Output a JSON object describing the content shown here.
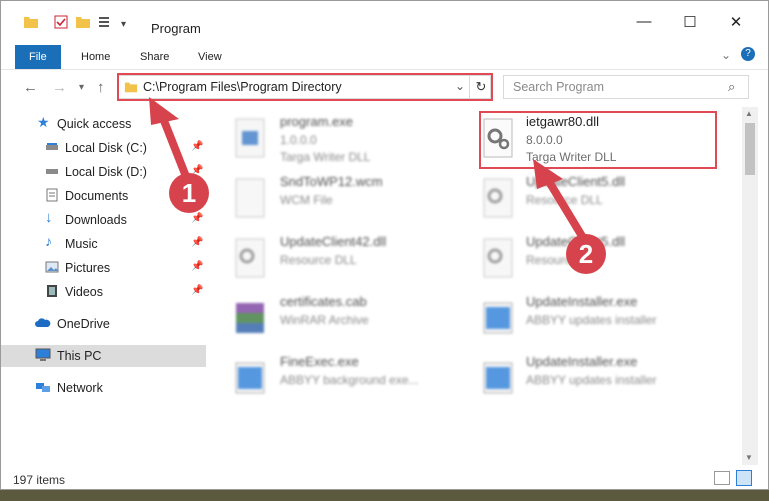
{
  "window": {
    "title": "Program",
    "minimize": "—",
    "maximize": "☐",
    "close": "✕"
  },
  "ribbon": {
    "tabs": [
      "File",
      "Home",
      "Share",
      "View"
    ]
  },
  "nav": {
    "address": "C:\\Program Files\\Program Directory",
    "search_placeholder": "Search Program"
  },
  "sidebar": {
    "items": [
      {
        "label": "Quick access"
      },
      {
        "label": "Local Disk (C:)"
      },
      {
        "label": "Local Disk (D:)"
      },
      {
        "label": "Documents"
      },
      {
        "label": "Downloads"
      },
      {
        "label": "Music"
      },
      {
        "label": "Pictures"
      },
      {
        "label": "Videos"
      },
      {
        "label": "OneDrive"
      },
      {
        "label": "This PC"
      },
      {
        "label": "Network"
      }
    ]
  },
  "files": [
    {
      "name": "program.exe",
      "line2": "1.0.0.0",
      "line3": "Targa Writer DLL"
    },
    {
      "name": "ietgawr80.dll",
      "line2": "8.0.0.0",
      "line3": "Targa Writer DLL"
    },
    {
      "name": "SndToWP12.wcm",
      "line2": "WCM File",
      "line3": ""
    },
    {
      "name": "UpdateClient5.dll",
      "line2": "Resource DLL",
      "line3": ""
    },
    {
      "name": "UpdateClient42.dll",
      "line2": "Resource DLL",
      "line3": ""
    },
    {
      "name": "UpdateClient5.dll",
      "line2": "Resource DLL",
      "line3": ""
    },
    {
      "name": "certificates.cab",
      "line2": "WinRAR Archive",
      "line3": ""
    },
    {
      "name": "UpdateInstaller.exe",
      "line2": "ABBYY updates installer",
      "line3": ""
    },
    {
      "name": "FineExec.exe",
      "line2": "ABBYY background exe...",
      "line3": ""
    },
    {
      "name": "UpdateInstaller.exe",
      "line2": "ABBYY updates installer",
      "line3": ""
    }
  ],
  "status": {
    "count": "197 items"
  },
  "markers": [
    "1",
    "2"
  ]
}
